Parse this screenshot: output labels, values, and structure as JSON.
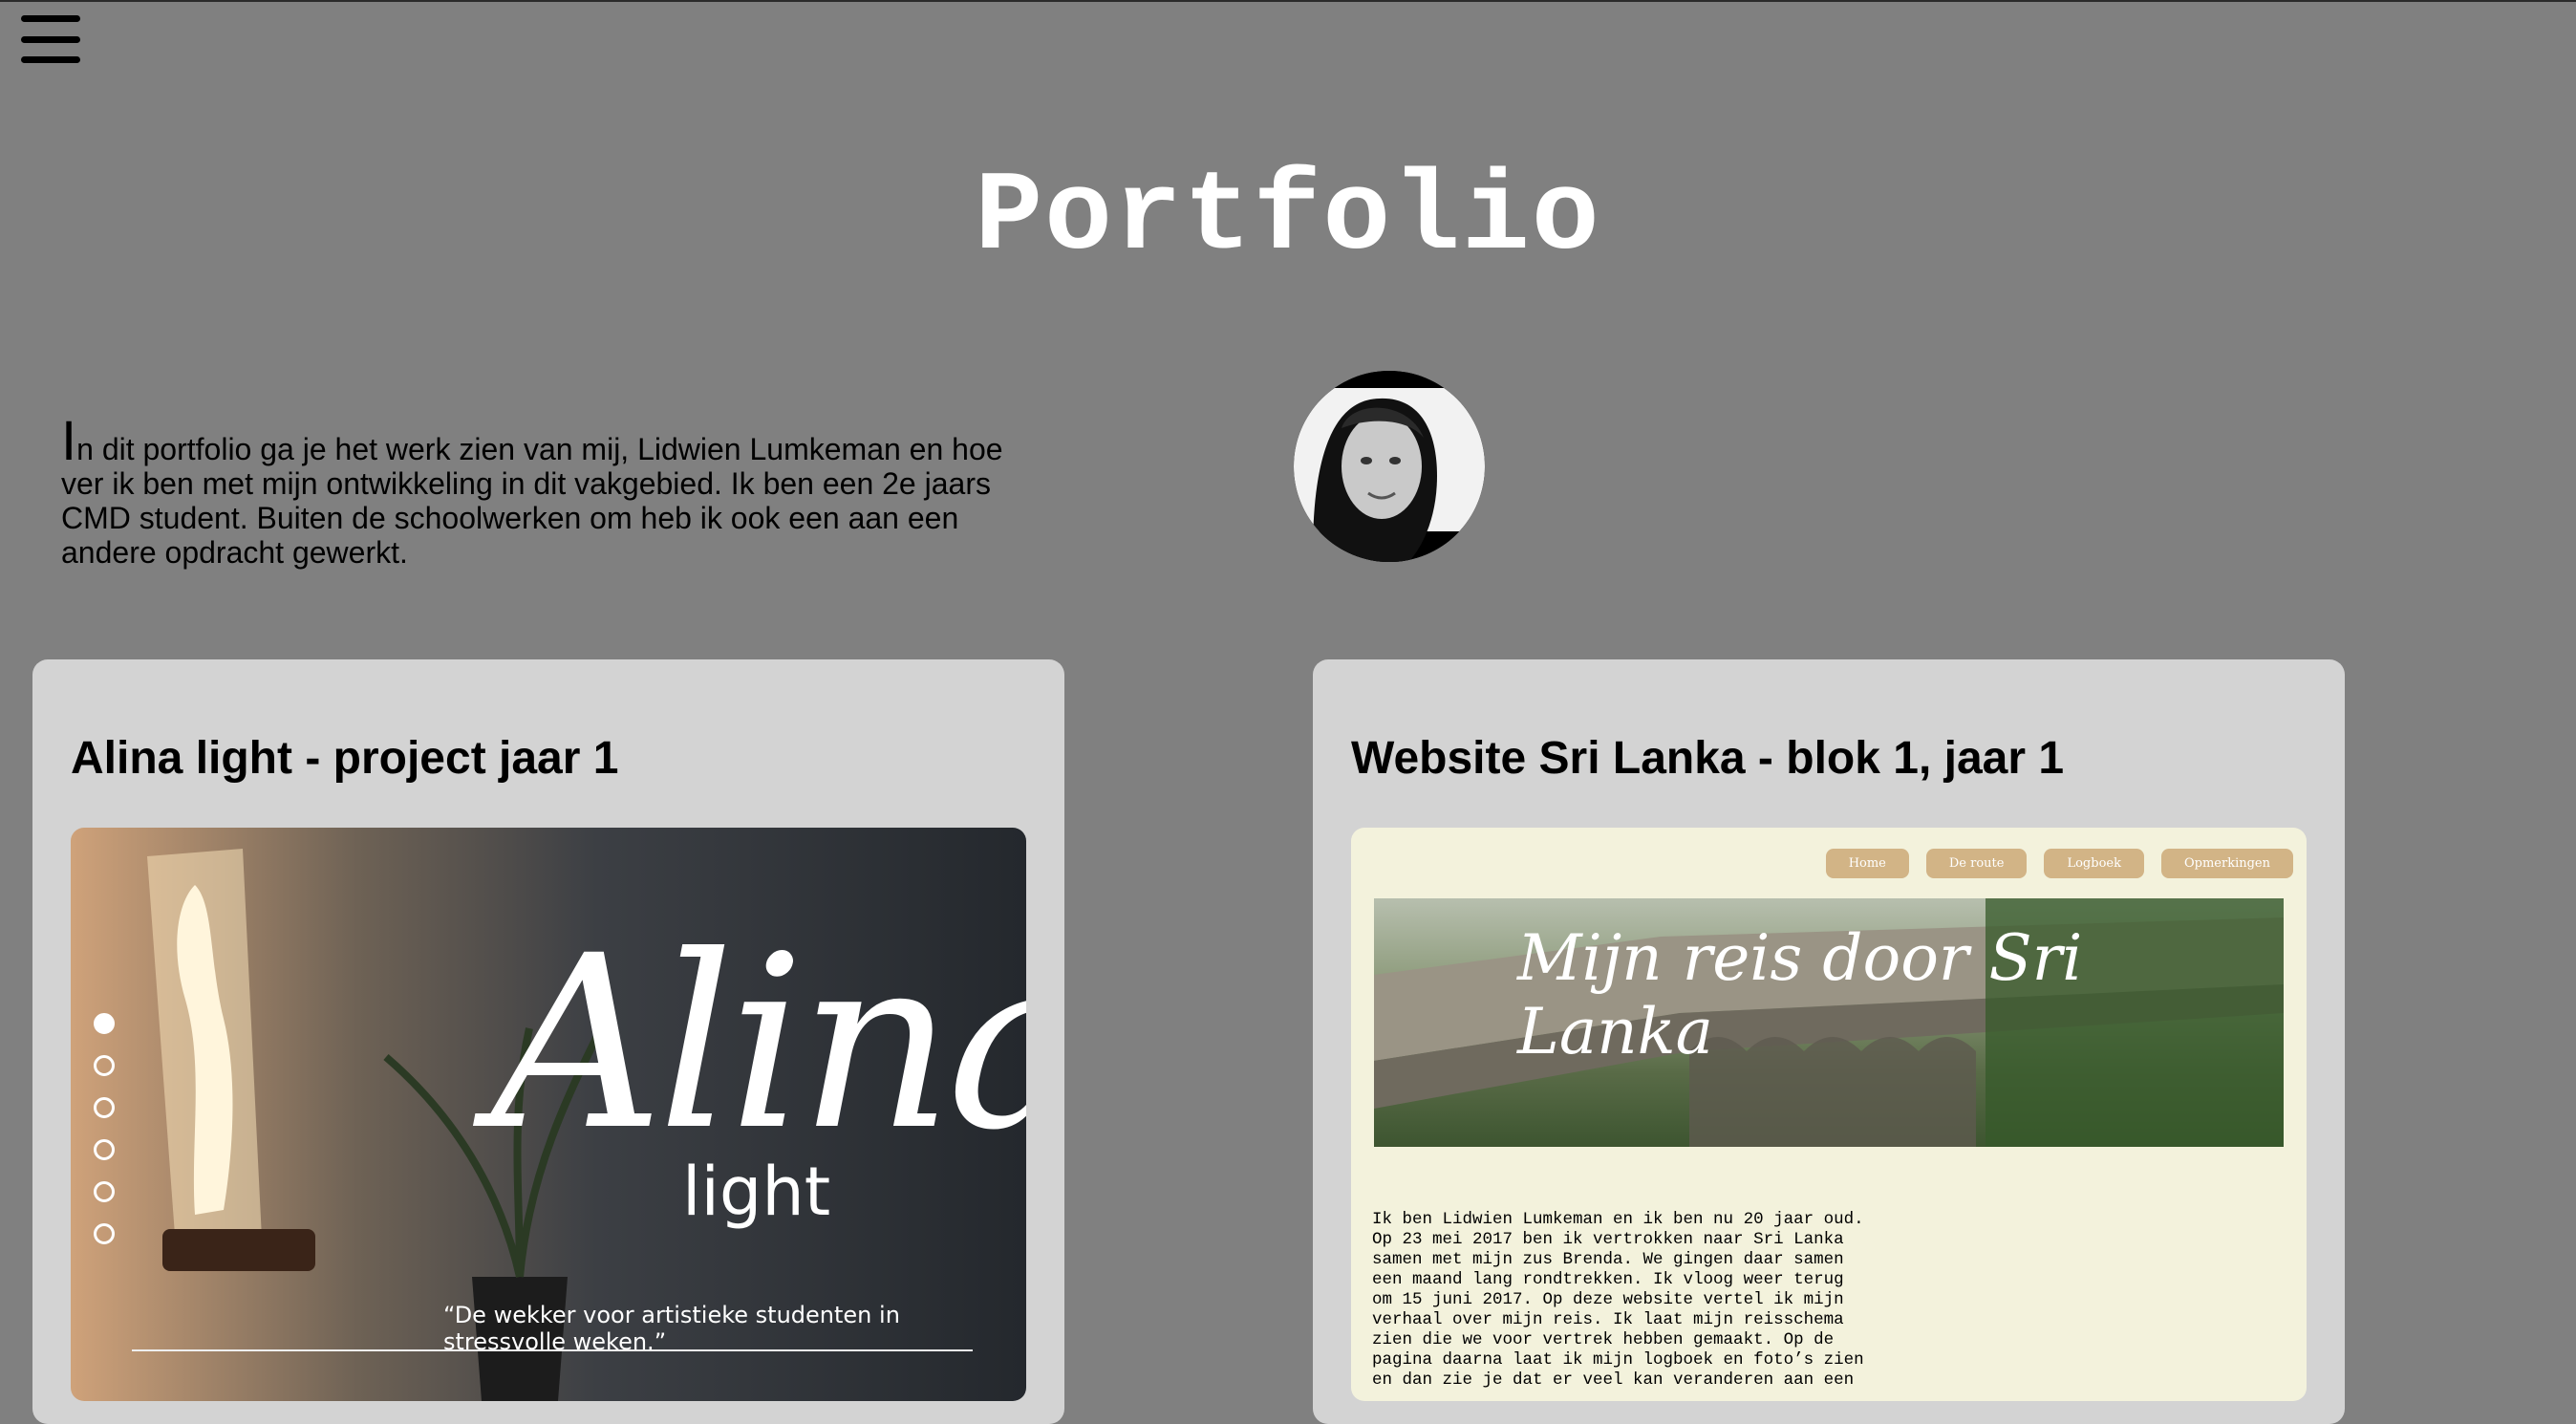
{
  "header": {
    "title": "Portfolio",
    "menu_icon": "hamburger-icon"
  },
  "intro": {
    "dropcap": "I",
    "text": "n dit portfolio ga je het werk zien van mij, Lidwien Lumkeman en hoe ver ik ben met mijn ontwikkeling in dit vakgebied. Ik ben een 2e jaars CMD student. Buiten de schoolwerken om heb ik ook een aan een andere opdracht gewerkt."
  },
  "projects": [
    {
      "title": "Alina light - project jaar 1",
      "preview": {
        "word": "Alina",
        "subword": "light",
        "tagline": "“De wekker voor artistieke studenten in stressvolle weken.”",
        "slides": 6
      }
    },
    {
      "title": "Website Sri Lanka - blok 1, jaar 1",
      "preview": {
        "nav": [
          "Home",
          "De route",
          "Logboek",
          "Opmerkingen"
        ],
        "hero_title": "Mijn reis door Sri Lanka",
        "body": "Ik ben Lidwien Lumkeman en ik ben nu 20 jaar oud.\nOp 23 mei 2017 ben ik vertrokken naar Sri Lanka\nsamen met mijn zus Brenda. We gingen daar samen\neen maand lang rondtrekken. Ik vloog weer terug\nom 15 juni 2017. Op deze website vertel ik mijn\nverhaal over mijn reis. Ik laat mijn reisschema\nzien die we voor vertrek hebben gemaakt. Op de\npagina daarna laat ik mijn logboek en foto’s zien\nen dan zie je dat er veel kan veranderen aan een"
      }
    }
  ]
}
